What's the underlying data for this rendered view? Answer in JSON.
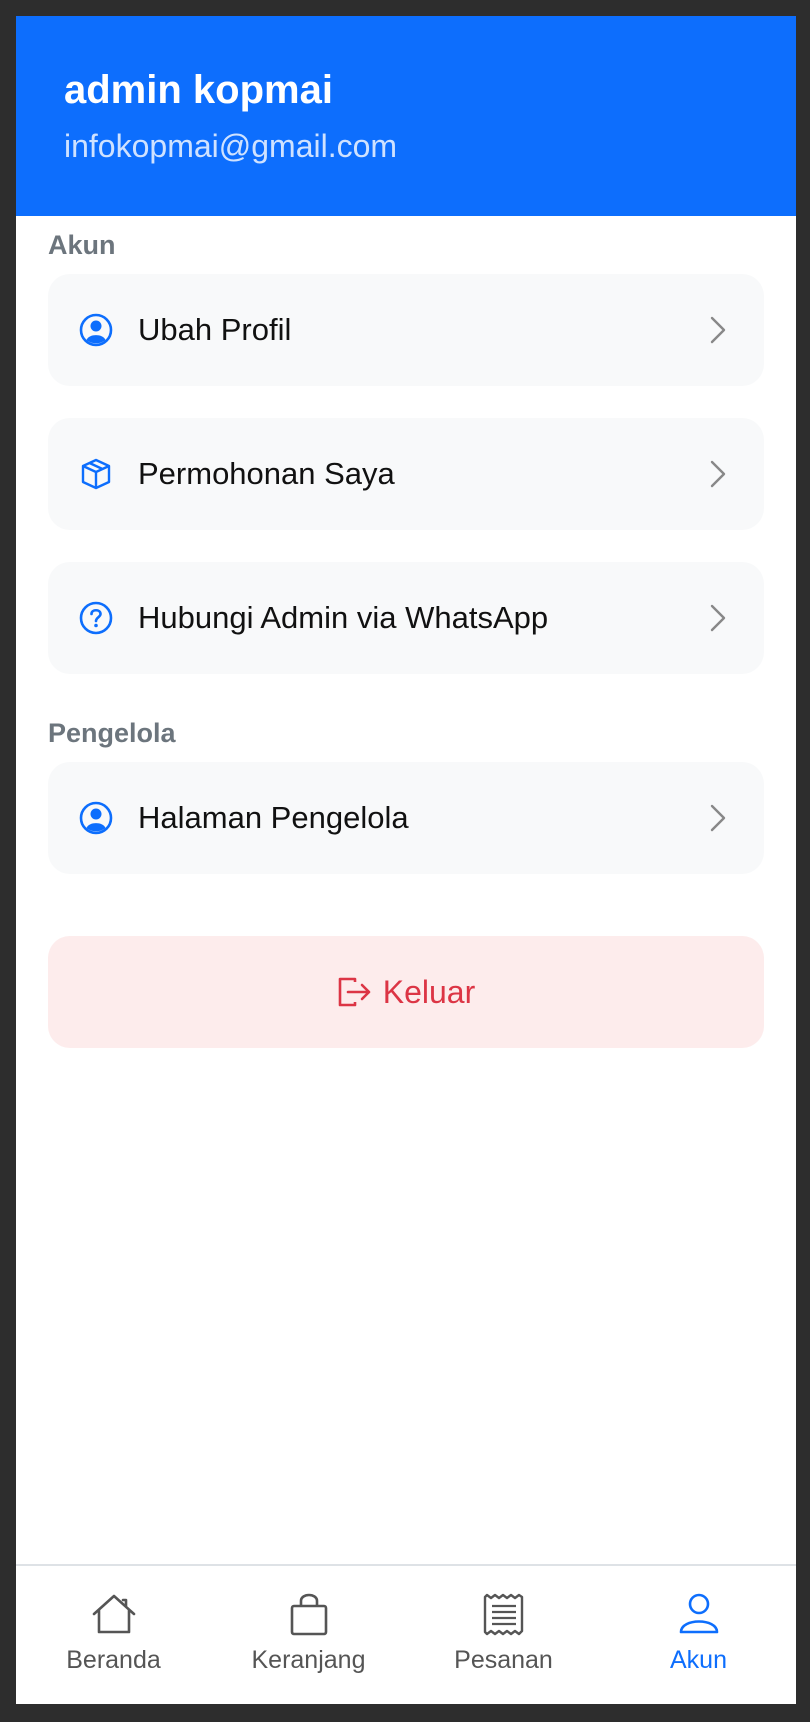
{
  "header": {
    "name": "admin kopmai",
    "email": "infokopmai@gmail.com"
  },
  "sections": {
    "account": {
      "title": "Akun",
      "items": [
        {
          "label": "Ubah Profil",
          "icon": "user-circle-icon"
        },
        {
          "label": "Permohonan Saya",
          "icon": "box-icon"
        },
        {
          "label": "Hubungi Admin via WhatsApp",
          "icon": "question-circle-icon"
        }
      ]
    },
    "manager": {
      "title": "Pengelola",
      "items": [
        {
          "label": "Halaman Pengelola",
          "icon": "user-circle-icon"
        }
      ]
    }
  },
  "logout": {
    "label": "Keluar",
    "icon": "logout-icon"
  },
  "tabbar": {
    "items": [
      {
        "label": "Beranda",
        "icon": "home-icon"
      },
      {
        "label": "Keranjang",
        "icon": "bag-icon"
      },
      {
        "label": "Pesanan",
        "icon": "receipt-icon"
      },
      {
        "label": "Akun",
        "icon": "person-icon"
      }
    ],
    "active": "Akun"
  },
  "colors": {
    "primary": "#0d6efd",
    "danger": "#dc3545",
    "danger_bg": "#fdecec",
    "item_bg": "#f8f9fa",
    "muted": "#6c757d"
  }
}
